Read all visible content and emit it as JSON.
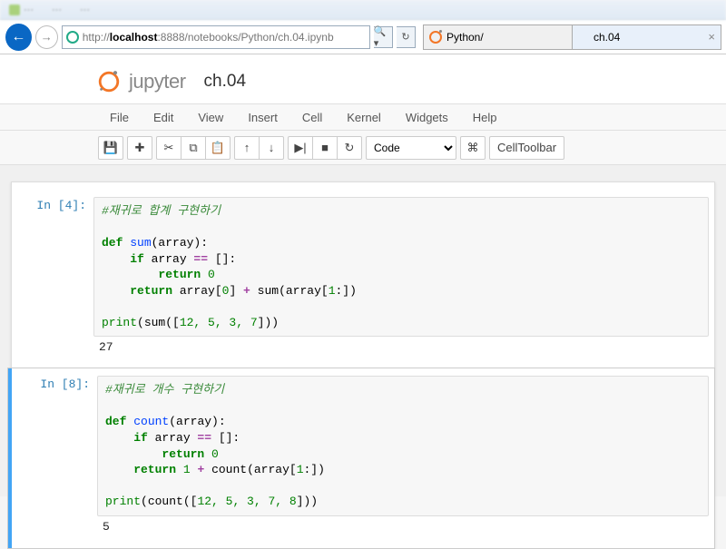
{
  "browser": {
    "url_host": "localhost",
    "url_port": ":8888",
    "url_path": "/notebooks/Python/ch.04.ipynb",
    "search_hint": "🔍 ▾",
    "refresh_hint": "↻",
    "tabs": [
      {
        "label": "Python/"
      },
      {
        "label": "ch.04"
      }
    ]
  },
  "jupyter": {
    "logo_text": "jupyter",
    "notebook_name": "ch.04",
    "menu": [
      "File",
      "Edit",
      "View",
      "Insert",
      "Cell",
      "Kernel",
      "Widgets",
      "Help"
    ],
    "toolbar": {
      "save": "💾",
      "add": "✚",
      "cut": "✂",
      "copy": "⧉",
      "paste": "📋",
      "up": "↑",
      "down": "↓",
      "run": "▶|",
      "stop": "■",
      "restart": "↻",
      "celltype": "Code",
      "cmd": "⌘",
      "celltoolbar": "CellToolbar"
    }
  },
  "cells": [
    {
      "prompt": "In [4]:",
      "code": {
        "comment": "#재귀로 합계 구현하기",
        "def": "def ",
        "fname": "sum",
        "sig": "(array):",
        "if_line": "    if",
        "cond": " array ",
        "eq": "==",
        "empty": " []:",
        "ret1_kw": "        return ",
        "ret1_v": "0",
        "ret2_kw": "    return",
        "ret2_body": " array[",
        "idx0": "0",
        "ret2_mid": "] ",
        "plus": "+",
        "ret2_call": " sum(array[",
        "idx1": "1",
        "ret2_end": ":])",
        "print_kw": "print",
        "print_arg_open": "(sum([",
        "print_nums": "12, 5, 3, 7",
        "print_arg_close": "]))"
      },
      "output": "27"
    },
    {
      "prompt": "In [8]:",
      "code": {
        "comment": "#재귀로 개수 구현하기",
        "def": "def ",
        "fname": "count",
        "sig": "(array):",
        "if_line": "    if",
        "cond": " array ",
        "eq": "==",
        "empty": " []:",
        "ret1_kw": "        return ",
        "ret1_v": "0",
        "ret2_kw": "    return ",
        "one": "1",
        "sp": " ",
        "plus": "+",
        "ret2_call": " count(array[",
        "idx1": "1",
        "ret2_end": ":])",
        "print_kw": "print",
        "print_arg_open": "(count([",
        "print_nums": "12, 5, 3, 7, 8",
        "print_arg_close": "]))"
      },
      "output": "5"
    }
  ]
}
